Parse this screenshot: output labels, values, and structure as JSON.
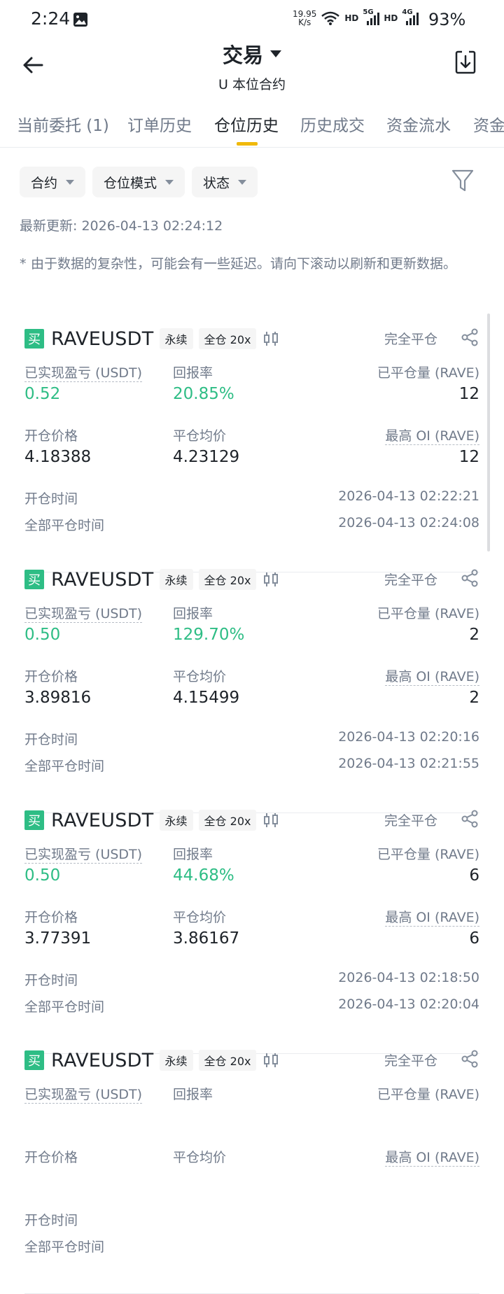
{
  "status_bar": {
    "time": "2:24",
    "net_speed_value": "19.95",
    "net_speed_unit": "K/s",
    "hd1": "HD",
    "sig1": "5G",
    "hd2": "HD",
    "sig2": "4G",
    "battery": "93%"
  },
  "header": {
    "title": "交易",
    "subtitle": "U 本位合约"
  },
  "tabs": [
    {
      "label": "当前委托 (1)"
    },
    {
      "label": "订单历史"
    },
    {
      "label": "仓位历史",
      "active": true
    },
    {
      "label": "历史成交"
    },
    {
      "label": "资金流水"
    },
    {
      "label": "资金"
    }
  ],
  "filters": [
    {
      "label": "合约"
    },
    {
      "label": "仓位模式"
    },
    {
      "label": "状态"
    }
  ],
  "last_updated": "最新更新: 2026-04-13 02:24:12",
  "note_star": "*",
  "note": "由于数据的复杂性，可能会有一些延迟。请向下滚动以刷新和更新数据。",
  "labels": {
    "buy": "买",
    "pnl": "已实现盈亏 (USDT)",
    "roi": "回报率",
    "closed_qty": "已平仓量 (RAVE)",
    "open_price": "开仓价格",
    "close_avg": "平仓均价",
    "max_oi": "最高 OI (RAVE)",
    "open_time": "开仓时间",
    "close_time": "全部平仓时间"
  },
  "positions": [
    {
      "symbol": "RAVEUSDT",
      "type": "永续",
      "margin": "全仓 20x",
      "status": "完全平仓",
      "pnl": "0.52",
      "roi": "20.85%",
      "closed_qty": "12",
      "open_price": "4.18388",
      "close_avg": "4.23129",
      "max_oi": "12",
      "open_time": "2026-04-13 02:22:21",
      "close_time": "2026-04-13 02:24:08"
    },
    {
      "symbol": "RAVEUSDT",
      "type": "永续",
      "margin": "全仓 20x",
      "status": "完全平仓",
      "pnl": "0.50",
      "roi": "129.70%",
      "closed_qty": "2",
      "open_price": "3.89816",
      "close_avg": "4.15499",
      "max_oi": "2",
      "open_time": "2026-04-13 02:20:16",
      "close_time": "2026-04-13 02:21:55"
    },
    {
      "symbol": "RAVEUSDT",
      "type": "永续",
      "margin": "全仓 20x",
      "status": "完全平仓",
      "pnl": "0.50",
      "roi": "44.68%",
      "closed_qty": "6",
      "open_price": "3.77391",
      "close_avg": "3.86167",
      "max_oi": "6",
      "open_time": "2026-04-13 02:18:50",
      "close_time": "2026-04-13 02:20:04"
    },
    {
      "symbol": "RAVEUSDT",
      "type": "永续",
      "margin": "全仓 20x",
      "status": "完全平仓"
    }
  ],
  "colors": {
    "accent": "#f0b90b",
    "profit": "#2ebd85",
    "muted": "#707a8a",
    "text": "#1e2329"
  }
}
